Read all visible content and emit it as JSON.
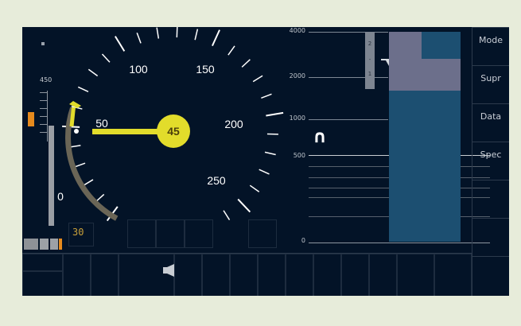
{
  "speedometer": {
    "current_speed": "45",
    "target_speed": "30",
    "dial_labels": [
      "0",
      "50",
      "100",
      "150",
      "200",
      "250"
    ],
    "left_scale_label": "450"
  },
  "planning": {
    "distance_labels": [
      "4000",
      "2000",
      "1000",
      "500",
      "0"
    ],
    "gradient_digits": [
      "2",
      "-",
      "1"
    ],
    "track_symbol": "∩"
  },
  "sidebar": {
    "buttons": [
      {
        "label": "Mode"
      },
      {
        "label": "Supr"
      },
      {
        "label": "Data"
      },
      {
        "label": "Spec"
      }
    ]
  },
  "colors": {
    "background": "#031327",
    "speed_needle": "#e2dc2b",
    "planning_block": "#1c4f71",
    "restriction_block": "#6c6f8b"
  },
  "icons": [
    "speaker-icon",
    "tunnel-icon",
    "flag-marker-icon"
  ]
}
